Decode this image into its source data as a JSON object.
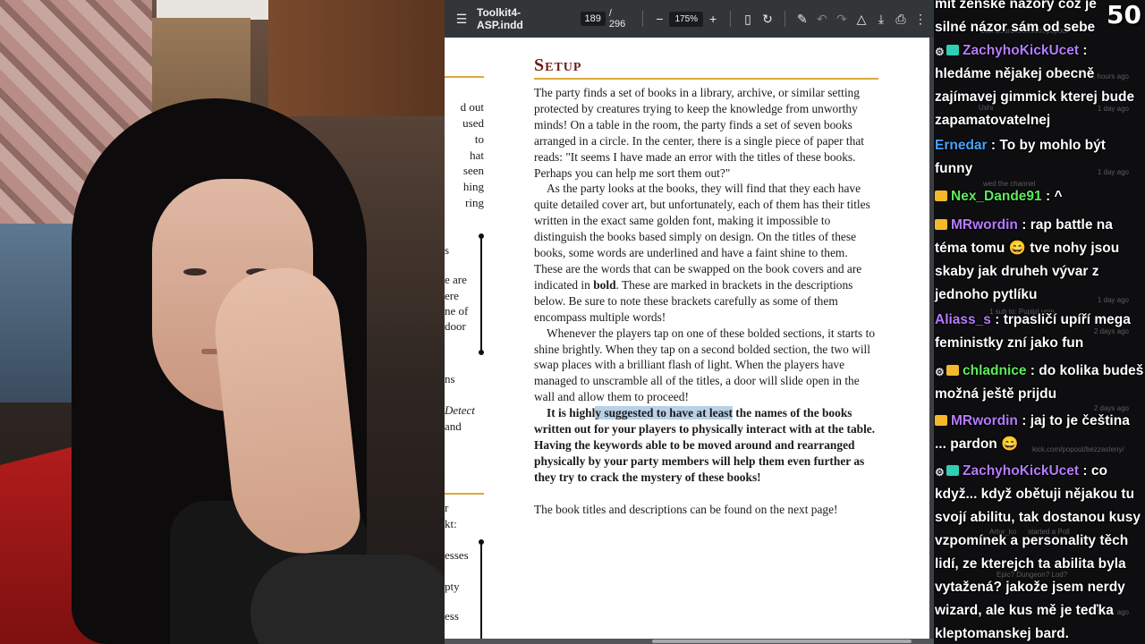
{
  "viewer": {
    "doc_title": "Toolkit4-ASP.indd",
    "page_current": "189",
    "page_total": "/ 296",
    "zoom": "175%"
  },
  "page": {
    "heading": "Setup",
    "paragraphs": [
      "The party finds a set of books in a library, archive, or similar setting protected by creatures trying to keep the knowledge from unworthy minds! On a table in the room, the party finds a set of seven books arranged in a circle. In the center, there is a single piece of paper that reads: \"It seems I have made an error with the titles of these books. Perhaps you can help me sort them out?\"",
      "Whenever the players tap on one of these bolded sections, it starts to shine brightly. When they tap on a second bolded section, the two will swap places with a brilliant flash of light. When the players have managed to unscramble all of the titles, a door will slide open in the wall and allow them to proceed!",
      "The book titles and descriptions can be found on the next page!"
    ],
    "p2_before_bold": "As the party looks at the books, they will find that they each have quite detailed cover art, but unfortunately, each of them has their titles written in the exact same golden font, making it impossible to distinguish the books based simply on design. On the titles of these books, some words are underlined and have a faint shine to them. These are the words that can be swapped on the book covers and are indicated in ",
    "p2_bold": "bold",
    "p2_after_bold": ". These are marked in brackets in the descriptions below. Be sure to note these brackets carefully as some of them encompass multiple words!",
    "p4_pre": "It is highl",
    "p4_highlight": "y suggested to have at least",
    "p4_post": " the names of the books written out for your players to physically interact with at the table. Having the keywords able to be moved around and rearranged physically by your party members will help them even further as they try to crack the mystery of these books!",
    "left_fragments": [
      "d out",
      "used",
      "to",
      "hat",
      "seen",
      "hing",
      "ring",
      "s",
      "e are",
      "ere",
      "ne of",
      "door",
      "ns",
      "Detect",
      "and",
      "r",
      "kt:",
      "esses",
      "pty",
      "ess"
    ]
  },
  "chat": {
    "counter": "50",
    "messages": [
      {
        "user": "",
        "text": "mit ženské názory což je silné názor sám od sebe",
        "user_color": "#ffffff",
        "badge": "none"
      },
      {
        "user": "ZachyhoKickUcet",
        "text": "hledáme nějakej obecně zajímavej gimmick kterej bude zapamatovatelnej",
        "user_color": "#b67bff",
        "badge": "bot"
      },
      {
        "user": "Ernedar",
        "text": "To by mohlo být funny",
        "user_color": "#4aa2ff",
        "badge": "none"
      },
      {
        "user": "Nex_Dande91",
        "text": "^",
        "user_color": "#5eea5e",
        "badge": "crown"
      },
      {
        "user": "MRwordin",
        "text": "rap battle na téma tomu 😄 tve nohy jsou skaby jak druheh vývar z jednoho pytlíku",
        "user_color": "#b67bff",
        "badge": "crown"
      },
      {
        "user": "Aliass_s",
        "text": "trpasličí upíří mega feministky zní jako fun",
        "user_color": "#b67bff",
        "badge": "none"
      },
      {
        "user": "chladnice",
        "text": "do kolika budeš možná ještě prijdu",
        "user_color": "#5eea5e",
        "badge": "crown"
      },
      {
        "user": "MRwordin",
        "text": "jaj to je čeština ... pardon 😄",
        "user_color": "#b67bff",
        "badge": "crown"
      },
      {
        "user": "ZachyhoKickUcet",
        "text": "co když... když obětuji nějakou tu svojí abilitu, tak dostanou kusy vzpomínek a personality těch lidí, ze kterejch ta abilita byla vytažená? jakože jsem nerdy wizard, ale kus mě je teďka kleptomanskej bard.",
        "user_color": "#b67bff",
        "badge": "bot"
      }
    ],
    "ghost_texts": [
      "dashboard.kick.com/popout",
      "2 hours ago",
      "Ushi",
      "1 day ago",
      "1 day ago",
      "wed the channel",
      "1 day ago",
      "1 sub to: PupipLupin",
      "2 days ago",
      "started a Poll",
      "Artur_ko",
      "kick.com/popout/bezzasteny/",
      "2 days ago",
      "Epic? Dungeon? Lod?",
      "12 hours ago"
    ]
  }
}
